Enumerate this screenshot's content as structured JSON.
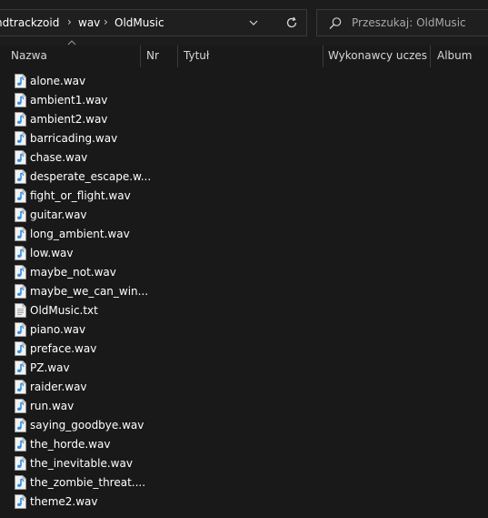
{
  "address_bar": {
    "crumbs": [
      "ndtrackzoid",
      "wav",
      "OldMusic"
    ],
    "dropdown_icon": "chevron-down-icon",
    "refresh_icon": "refresh-icon"
  },
  "search": {
    "placeholder": "Przeszukaj: OldMusic",
    "icon": "search-icon"
  },
  "columns": {
    "name": "Nazwa",
    "number": "Nr",
    "title": "Tytuł",
    "artists": "Wykonawcy uczes...",
    "album": "Album"
  },
  "files": [
    {
      "name": "alone.wav",
      "type": "audio"
    },
    {
      "name": "ambient1.wav",
      "type": "audio"
    },
    {
      "name": "ambient2.wav",
      "type": "audio"
    },
    {
      "name": "barricading.wav",
      "type": "audio"
    },
    {
      "name": "chase.wav",
      "type": "audio"
    },
    {
      "name": "desperate_escape.w...",
      "type": "audio"
    },
    {
      "name": "fight_or_flight.wav",
      "type": "audio"
    },
    {
      "name": "guitar.wav",
      "type": "audio"
    },
    {
      "name": "long_ambient.wav",
      "type": "audio"
    },
    {
      "name": "low.wav",
      "type": "audio"
    },
    {
      "name": "maybe_not.wav",
      "type": "audio"
    },
    {
      "name": "maybe_we_can_win...",
      "type": "audio"
    },
    {
      "name": "OldMusic.txt",
      "type": "text"
    },
    {
      "name": "piano.wav",
      "type": "audio"
    },
    {
      "name": "preface.wav",
      "type": "audio"
    },
    {
      "name": "PZ.wav",
      "type": "audio"
    },
    {
      "name": "raider.wav",
      "type": "audio"
    },
    {
      "name": "run.wav",
      "type": "audio"
    },
    {
      "name": "saying_goodbye.wav",
      "type": "audio"
    },
    {
      "name": "the_horde.wav",
      "type": "audio"
    },
    {
      "name": "the_inevitable.wav",
      "type": "audio"
    },
    {
      "name": "the_zombie_threat....",
      "type": "audio"
    },
    {
      "name": "theme2.wav",
      "type": "audio"
    }
  ],
  "colors": {
    "background": "#191919",
    "audio_icon_blue": "#2f8fe8",
    "text": "#ffffff"
  }
}
